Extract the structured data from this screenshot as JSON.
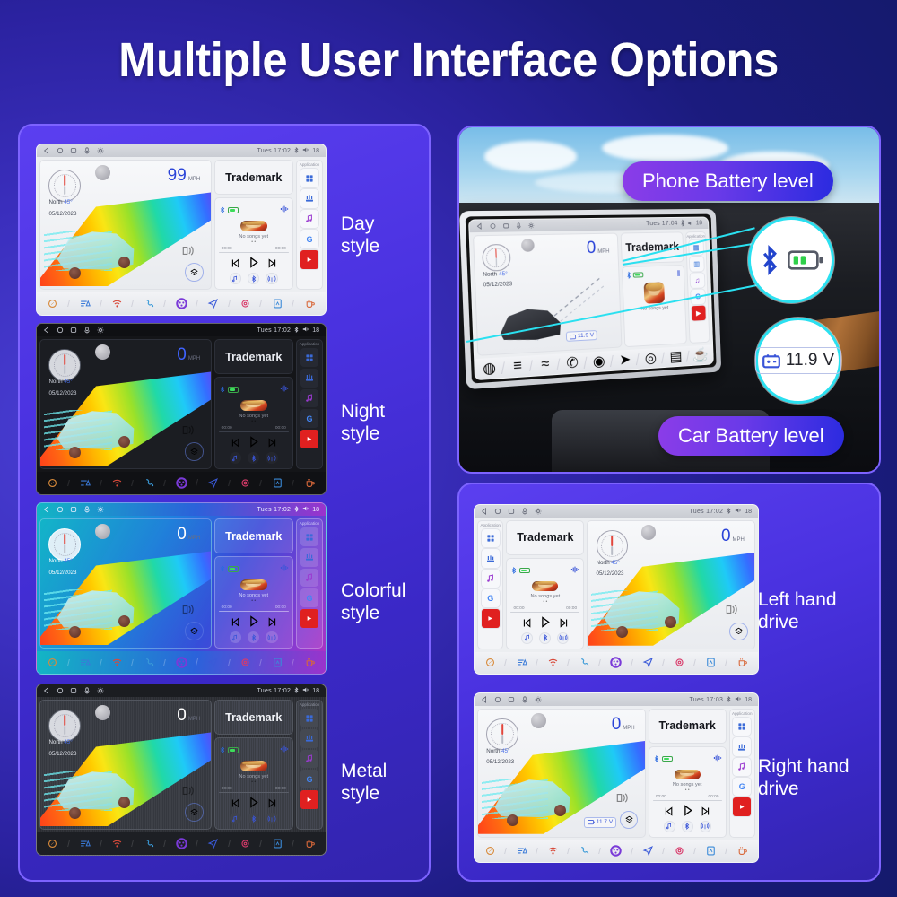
{
  "title": "Multiple User Interface Options",
  "theme_colors": {
    "background_start": "#4a3fd4",
    "background_end": "#141a6b",
    "panel_purple": "#4a32e0",
    "panel_border": "#7d63ff",
    "callout_gradient_start": "#8b3ce8",
    "callout_gradient_end": "#2b2be0",
    "bubble_ring": "#2ae0f0",
    "speed_blue": "#2a43d8",
    "battery_green": "#3ddc5a"
  },
  "styles_panel": {
    "items": [
      {
        "id": "day",
        "label_line1": "Day",
        "label_line2": "style",
        "screen": {
          "status": {
            "time": "Tues  17:02",
            "volume": "18",
            "icons": [
              "back-icon",
              "home-icon",
              "recents-icon",
              "mic-icon",
              "brightness-icon",
              "bluetooth-icon",
              "volume-icon"
            ]
          },
          "speed": "99",
          "speed_unit": "MPH",
          "compass_heading": "North",
          "compass_degrees": "45°",
          "date": "05/12/2023",
          "trademark": "Trademark",
          "media_status": "No songs yet",
          "time_elapsed": "00:00",
          "time_total": "00:00",
          "app_title": "Application",
          "apps": [
            "apps-grid-icon",
            "equalizer-icon",
            "music-note-icon",
            "google-icon",
            "youtube-icon"
          ],
          "dock": [
            "compass-dock-icon",
            "equalizer-dock-icon",
            "wifi-icon",
            "phone-icon",
            "apps-color-icon",
            "navigation-icon",
            "settings-gear-icon",
            "file-icon",
            "coffee-cup-icon"
          ],
          "voltage": ""
        }
      },
      {
        "id": "night",
        "label_line1": "Night",
        "label_line2": "style",
        "screen": {
          "status": {
            "time": "Tues  17:02",
            "volume": "18",
            "icons": [
              "back-icon",
              "home-icon",
              "recents-icon",
              "mic-icon",
              "brightness-icon",
              "bluetooth-icon",
              "volume-icon"
            ]
          },
          "speed": "0",
          "speed_unit": "MPH",
          "compass_heading": "North",
          "compass_degrees": "45°",
          "date": "05/12/2023",
          "trademark": "Trademark",
          "media_status": "No songs yet",
          "time_elapsed": "00:00",
          "time_total": "00:00",
          "app_title": "Application",
          "apps": [
            "apps-grid-icon",
            "equalizer-icon",
            "music-note-icon",
            "google-icon",
            "youtube-icon"
          ],
          "dock": [
            "compass-dock-icon",
            "equalizer-dock-icon",
            "wifi-icon",
            "phone-icon",
            "apps-color-icon",
            "navigation-icon",
            "settings-gear-icon",
            "file-icon",
            "coffee-cup-icon"
          ],
          "voltage": ""
        }
      },
      {
        "id": "colorful",
        "label_line1": "Colorful",
        "label_line2": "style",
        "screen": {
          "status": {
            "time": "Tues  17:02",
            "volume": "18",
            "icons": [
              "back-icon",
              "home-icon",
              "recents-icon",
              "mic-icon",
              "brightness-icon",
              "bluetooth-icon",
              "volume-icon"
            ]
          },
          "speed": "0",
          "speed_unit": "MPH",
          "compass_heading": "North",
          "compass_degrees": "45°",
          "date": "05/12/2023",
          "trademark": "Trademark",
          "media_status": "No songs yet",
          "time_elapsed": "00:00",
          "time_total": "00:00",
          "app_title": "Application",
          "apps": [
            "apps-grid-icon",
            "equalizer-icon",
            "music-note-icon",
            "google-icon",
            "youtube-icon"
          ],
          "dock": [
            "compass-dock-icon",
            "equalizer-dock-icon",
            "wifi-icon",
            "phone-icon",
            "apps-color-icon",
            "navigation-icon",
            "settings-gear-icon",
            "file-icon",
            "coffee-cup-icon"
          ],
          "voltage": ""
        }
      },
      {
        "id": "metal",
        "label_line1": "Metal",
        "label_line2": "style",
        "screen": {
          "status": {
            "time": "Tues  17:02",
            "volume": "18",
            "icons": [
              "back-icon",
              "home-icon",
              "recents-icon",
              "mic-icon",
              "brightness-icon",
              "bluetooth-icon",
              "volume-icon"
            ]
          },
          "speed": "0",
          "speed_unit": "MPH",
          "compass_heading": "North",
          "compass_degrees": "45°",
          "date": "05/12/2023",
          "trademark": "Trademark",
          "media_status": "No songs yet",
          "time_elapsed": "00:00",
          "time_total": "00:00",
          "app_title": "Application",
          "apps": [
            "apps-grid-icon",
            "equalizer-icon",
            "music-note-icon",
            "google-icon",
            "youtube-icon"
          ],
          "dock": [
            "compass-dock-icon",
            "equalizer-dock-icon",
            "wifi-icon",
            "phone-icon",
            "apps-color-icon",
            "navigation-icon",
            "settings-gear-icon",
            "file-icon",
            "coffee-cup-icon"
          ],
          "voltage": ""
        }
      }
    ]
  },
  "car_panel": {
    "callout_phone": "Phone Battery level",
    "callout_car": "Car Battery level",
    "bubble_phone_icons": [
      "bluetooth-icon",
      "battery-icon"
    ],
    "bubble_car_voltage": "11.9",
    "bubble_car_unit": "V",
    "screen": {
      "status": {
        "time": "Tues  17:04",
        "volume": "18"
      },
      "speed": "0",
      "speed_unit": "MPH",
      "compass_heading": "North",
      "compass_degrees": "45°",
      "date": "05/12/2023",
      "trademark": "Trademark",
      "media_status": "No songs yet",
      "app_title": "Application",
      "voltage": "11.9 V"
    }
  },
  "drive_panel": {
    "items": [
      {
        "id": "left-hand-drive",
        "label_line1": "Left hand",
        "label_line2": "drive",
        "layout": "left",
        "screen": {
          "status": {
            "time": "Tues  17:02",
            "volume": "18",
            "icons": [
              "back-icon",
              "home-icon",
              "recents-icon",
              "mic-icon",
              "brightness-icon",
              "bluetooth-icon",
              "volume-icon"
            ]
          },
          "speed": "0",
          "speed_unit": "MPH",
          "compass_heading": "North",
          "compass_degrees": "45°",
          "date": "05/12/2023",
          "trademark": "Trademark",
          "media_status": "No songs yet",
          "time_elapsed": "00:00",
          "time_total": "00:00",
          "app_title": "Application",
          "apps": [
            "apps-grid-icon",
            "equalizer-icon",
            "music-note-icon",
            "google-icon",
            "youtube-icon"
          ],
          "dock": [
            "compass-dock-icon",
            "equalizer-dock-icon",
            "wifi-icon",
            "phone-icon",
            "apps-color-icon",
            "navigation-icon",
            "settings-gear-icon",
            "file-icon",
            "coffee-cup-icon"
          ],
          "voltage": ""
        }
      },
      {
        "id": "right-hand-drive",
        "label_line1": "Right hand",
        "label_line2": "drive",
        "layout": "right",
        "screen": {
          "status": {
            "time": "Tues  17:03",
            "volume": "18",
            "icons": [
              "back-icon",
              "home-icon",
              "recents-icon",
              "mic-icon",
              "brightness-icon",
              "bluetooth-icon",
              "volume-icon"
            ]
          },
          "speed": "0",
          "speed_unit": "MPH",
          "compass_heading": "North",
          "compass_degrees": "45°",
          "date": "05/12/2023",
          "trademark": "Trademark",
          "media_status": "No songs yet",
          "time_elapsed": "00:00",
          "time_total": "00:00",
          "app_title": "Application",
          "apps": [
            "apps-grid-icon",
            "equalizer-icon",
            "music-note-icon",
            "google-icon",
            "youtube-icon"
          ],
          "dock": [
            "compass-dock-icon",
            "equalizer-dock-icon",
            "wifi-icon",
            "phone-icon",
            "apps-color-icon",
            "navigation-icon",
            "settings-gear-icon",
            "file-icon",
            "coffee-cup-icon"
          ],
          "voltage": "11.7 V"
        }
      }
    ]
  }
}
